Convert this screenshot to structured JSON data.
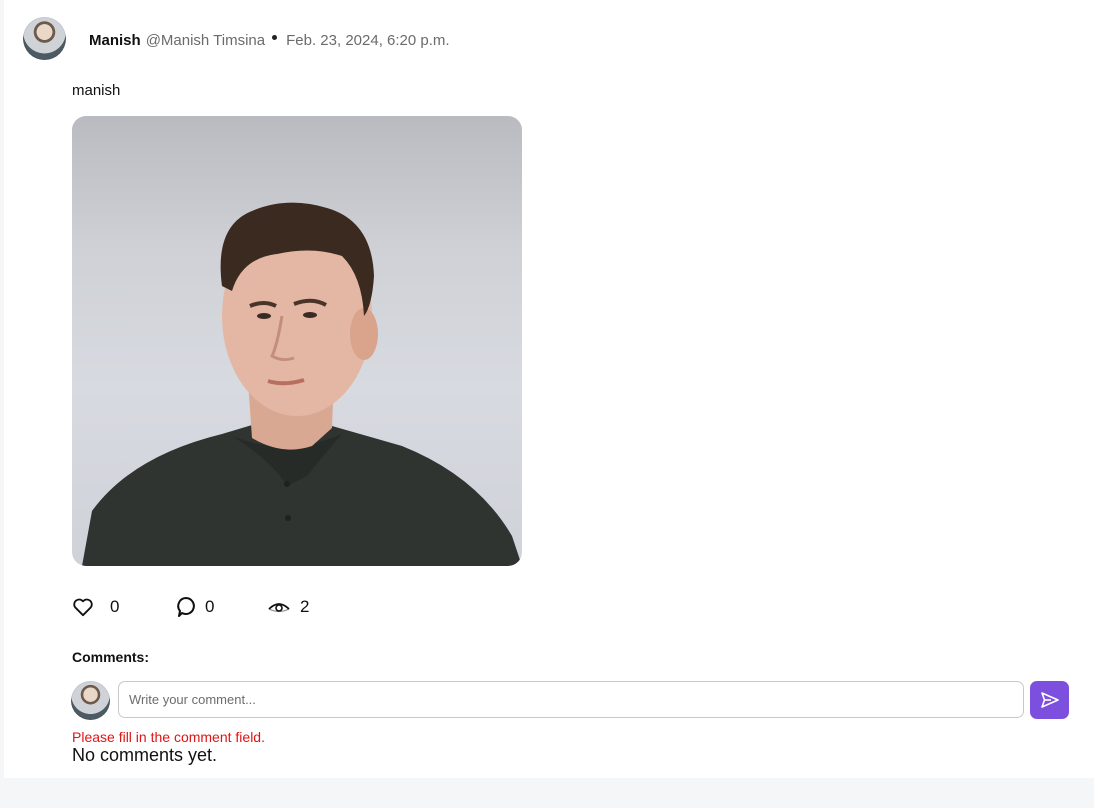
{
  "post": {
    "author_name": "Manish",
    "author_handle": "@Manish Timsina",
    "date": "Feb. 23, 2024, 6:20 p.m.",
    "text": "manish"
  },
  "stats": {
    "likes": "0",
    "comments": "0",
    "views": "2"
  },
  "comments": {
    "label": "Comments:",
    "input_placeholder": "Write your comment...",
    "input_value": "",
    "error": "Please fill in the comment field.",
    "empty": "No comments yet."
  },
  "colors": {
    "accent": "#7c4fde",
    "error": "#e01414",
    "muted_text": "#6b6b6b"
  },
  "icons": {
    "like": "heart-icon",
    "comment": "comment-bubble-icon",
    "views": "eye-icon",
    "send": "send-icon"
  }
}
